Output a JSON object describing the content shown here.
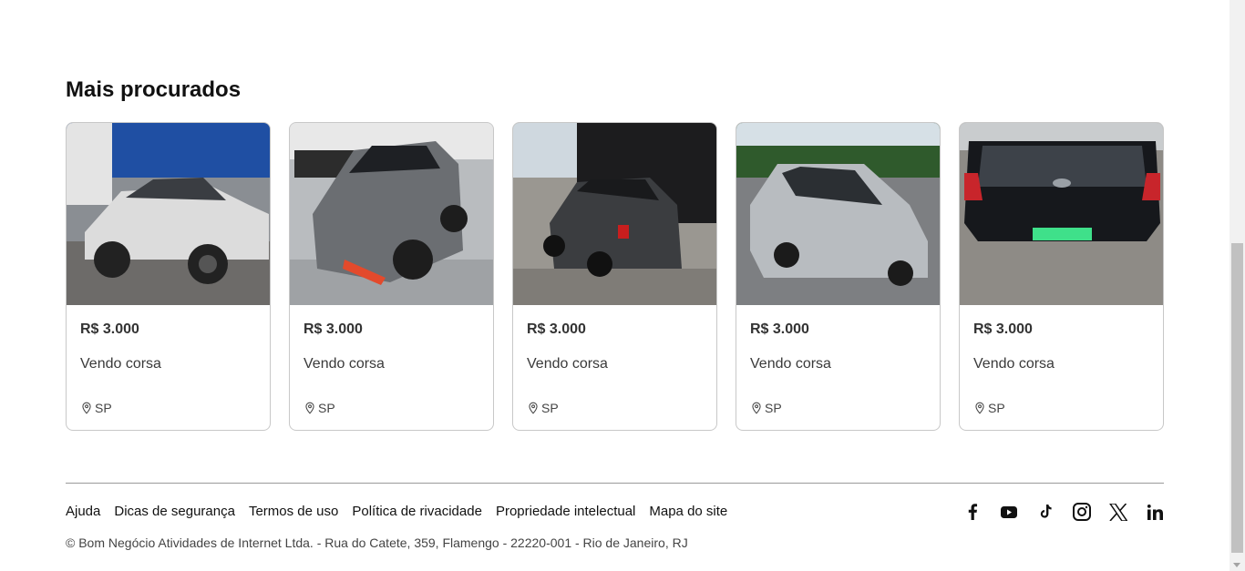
{
  "section": {
    "title": "Mais procurados"
  },
  "cards": [
    {
      "price": "R$ 3.000",
      "title": "Vendo corsa",
      "location": "SP",
      "image": "white-sedan"
    },
    {
      "price": "R$ 3.000",
      "title": "Vendo corsa",
      "location": "SP",
      "image": "grey-hatch-ev"
    },
    {
      "price": "R$ 3.000",
      "title": "Vendo corsa",
      "location": "SP",
      "image": "dark-hatch"
    },
    {
      "price": "R$ 3.000",
      "title": "Vendo corsa",
      "location": "SP",
      "image": "silver-honda"
    },
    {
      "price": "R$ 3.000",
      "title": "Vendo corsa",
      "location": "SP",
      "image": "black-hyundai-rear"
    }
  ],
  "footer": {
    "links": [
      "Ajuda",
      "Dicas de segurança",
      "Termos de uso",
      "Política de rivacidade",
      "Propriedade intelectual",
      "Mapa do site"
    ],
    "copyright": "© Bom Negócio Atividades de Internet Ltda. - Rua do Catete, 359, Flamengo - 22220-001 - Rio de Janeiro, RJ",
    "social": [
      "facebook-icon",
      "youtube-icon",
      "tiktok-icon",
      "instagram-icon",
      "x-icon",
      "linkedin-icon"
    ]
  }
}
